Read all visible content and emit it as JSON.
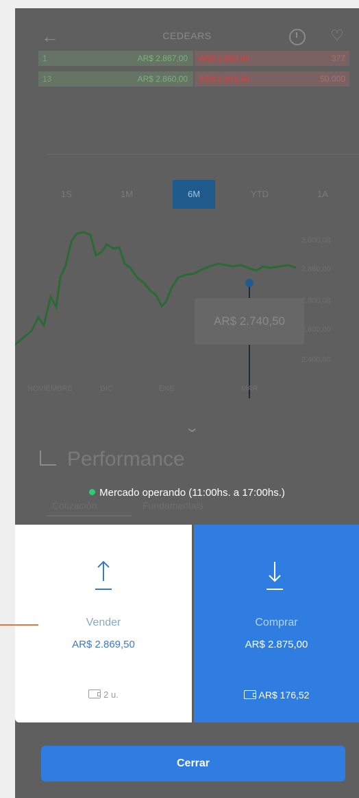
{
  "header": {
    "ticker": "CEDEARS",
    "icons": [
      "back-arrow-icon",
      "history-icon",
      "heart-icon"
    ]
  },
  "quotes": [
    {
      "qty": "1",
      "bid": "AR$ 2.867,00",
      "ask": "AR$ 2.880,00",
      "ask_qty": "377"
    },
    {
      "qty": "13",
      "bid": "AR$ 2.860,00",
      "ask": "AR$ 2.881,50",
      "ask_qty": "50.000"
    }
  ],
  "periods": [
    "1S",
    "1M",
    "6M",
    "YTD",
    "1A"
  ],
  "active_period": "6M",
  "chart": {
    "y_ticks": [
      "3.000,00",
      "2.860,00",
      "2.800,00",
      "2.600,00",
      "2.400,00"
    ],
    "x_ticks": [
      "NOVIEMBRE",
      "DIC",
      "ENE",
      "MAR"
    ],
    "tooltip": "AR$ 2.740,50"
  },
  "performance": {
    "title": "Performance",
    "tabs": [
      "Cotización",
      "Fundamentals"
    ]
  },
  "market_status": "Mercado operando (11:00hs. a 17:00hs.)",
  "sell": {
    "label": "Vender",
    "price": "AR$ 2.869,50",
    "units": "2 u."
  },
  "buy": {
    "label": "Comprar",
    "price": "AR$ 2.875,00",
    "cash": "AR$ 176,52"
  },
  "close_label": "Cerrar",
  "colors": {
    "accent": "#2f7de0",
    "callout": "#e4783b",
    "market_dot": "#2ecc71"
  }
}
